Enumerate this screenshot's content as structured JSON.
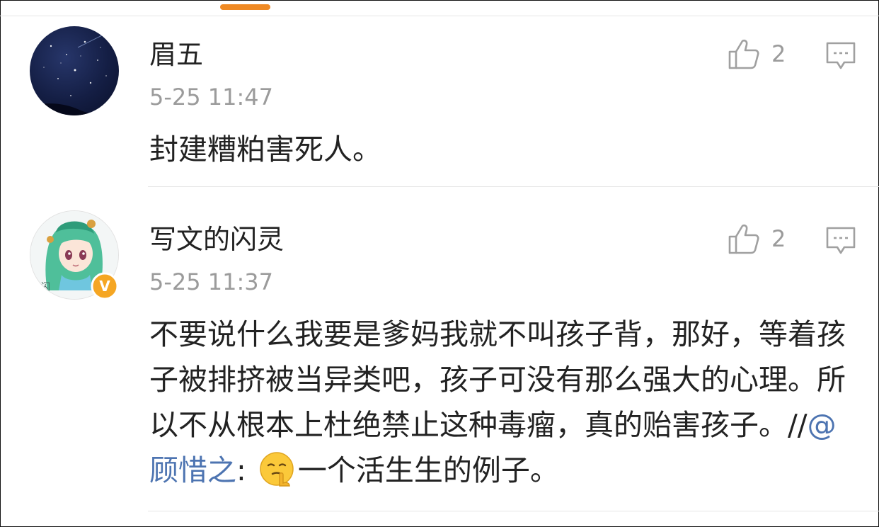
{
  "comments": [
    {
      "username": "眉五",
      "timestamp": "5-25 11:47",
      "likes": "2",
      "text": "封建糟粕害死人。",
      "avatar": "starry-night-avatar",
      "verified": false
    },
    {
      "username": "写文的闪灵",
      "timestamp": "5-25 11:37",
      "likes": "2",
      "text_before": "不要说什么我要是爹妈我就不叫孩子背，那好，等着孩子被排挤被当异类吧，孩子可没有那么强大的心理。所以不从根本上杜绝禁止这种毒瘤，真的贻害孩子。//",
      "mention": "@顾惜之",
      "text_colon": ": ",
      "emoji": "shushing-face-emoji",
      "text_after": "一个活生生的例子。",
      "avatar": "anime-girl-avatar",
      "verified": true,
      "verified_badge": "V"
    }
  ],
  "colors": {
    "accent": "#f08a24",
    "mention": "#4d74b1",
    "muted": "#9b9b9b",
    "verified": "#f5a623"
  },
  "icons": {
    "like": "thumbs-up-icon",
    "reply": "comment-bubble-icon"
  }
}
